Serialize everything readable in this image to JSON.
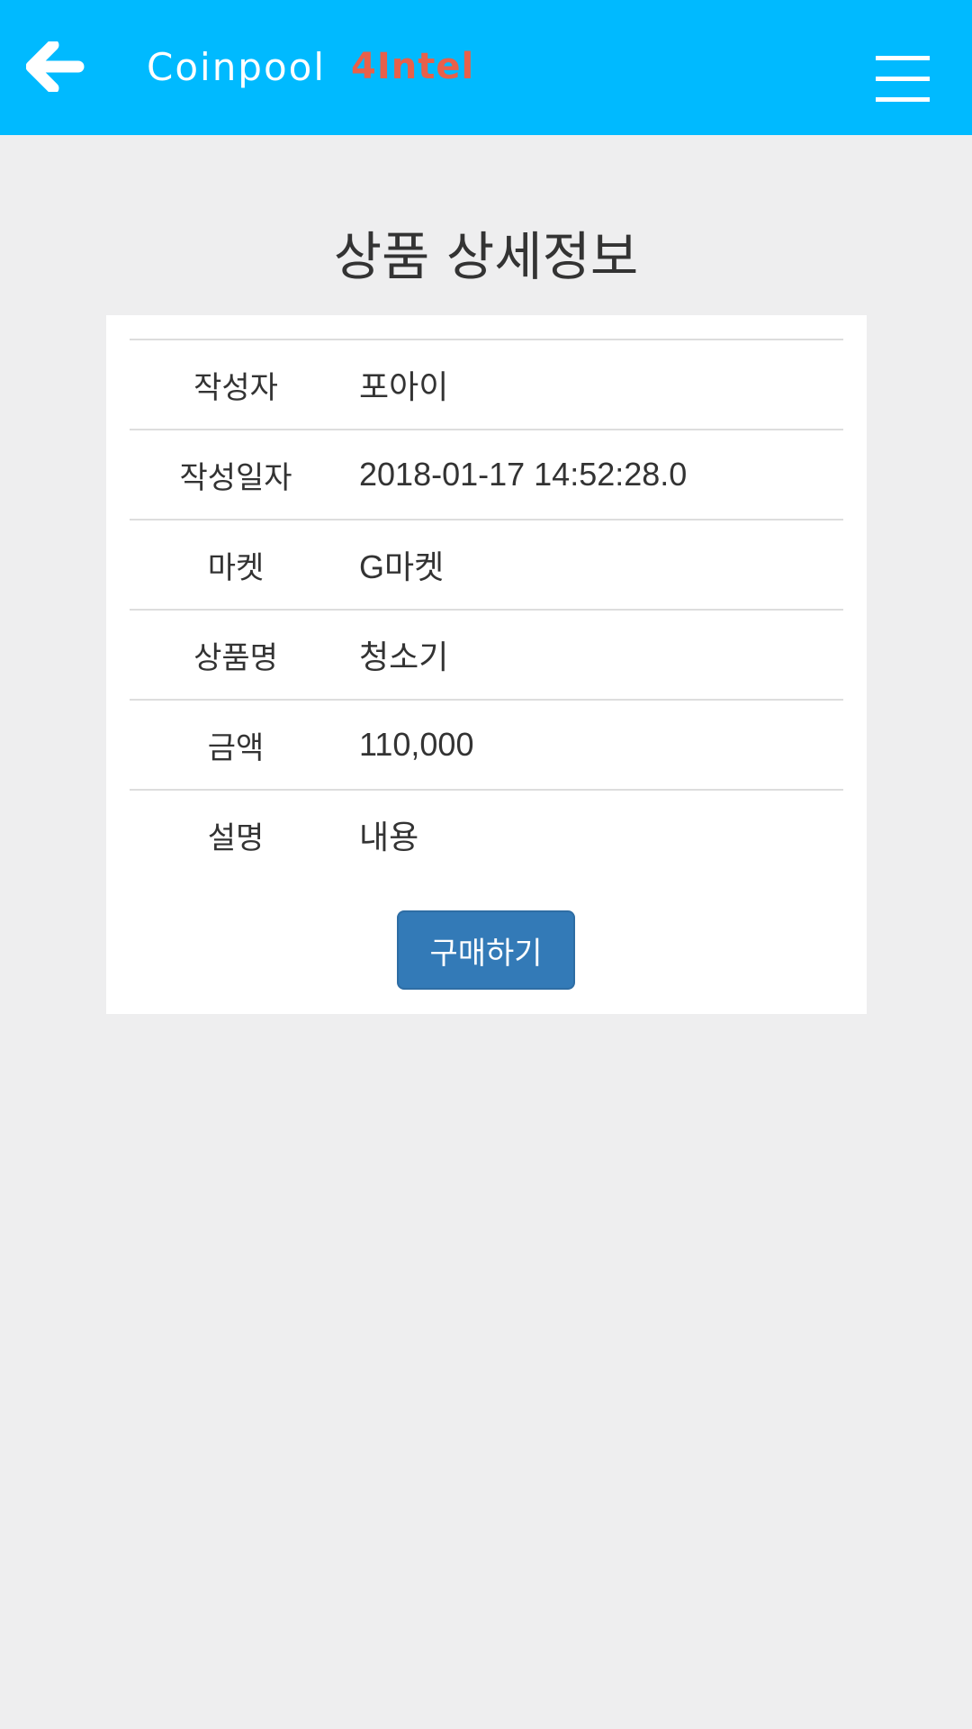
{
  "header": {
    "brand_name": "Coinpool",
    "brand_suffix": "4Intel",
    "back_icon": "arrow-left-icon",
    "menu_icon": "hamburger-menu-icon"
  },
  "page": {
    "title": "상품 상세정보"
  },
  "details": {
    "rows": [
      {
        "label": "작성자",
        "value": "포아이"
      },
      {
        "label": "작성일자",
        "value": "2018-01-17 14:52:28.0"
      },
      {
        "label": "마켓",
        "value": "G마켓"
      },
      {
        "label": "상품명",
        "value": "청소기"
      },
      {
        "label": "금액",
        "value": "110,000"
      },
      {
        "label": "설명",
        "value": "내용"
      }
    ],
    "buy_label": "구매하기"
  },
  "colors": {
    "header_bg": "#00baff",
    "brand_suffix": "#e8604a",
    "button_bg": "#337ab7",
    "page_bg": "#eeeeef"
  }
}
